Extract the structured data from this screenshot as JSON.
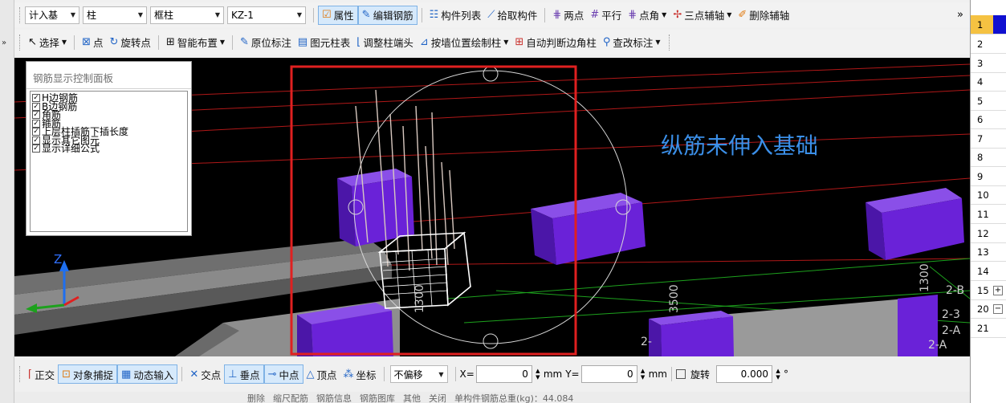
{
  "toolbar1": {
    "combo1": "计入基",
    "combo2": "柱",
    "combo3": "框柱",
    "combo4": "KZ-1",
    "properties": "属性",
    "edit_rebar": "编辑钢筋",
    "component_list": "构件列表",
    "pick_component": "拾取构件",
    "two_points": "两点",
    "parallel": "平行",
    "point_angle": "点角",
    "three_point_axis": "三点辅轴",
    "delete_axis": "删除辅轴",
    "overflow": "»"
  },
  "toolbar2": {
    "select": "选择",
    "point": "点",
    "rotate_point": "旋转点",
    "smart_layout": "智能布置",
    "in_place_label": "原位标注",
    "element_column_table": "图元柱表",
    "adjust_column_end": "调整柱端头",
    "draw_column_by_wall": "按墙位置绘制柱",
    "auto_corner_column": "自动判断边角柱",
    "check_label": "查改标注"
  },
  "panel": {
    "title": "钢筋显示控制面板",
    "items": [
      {
        "label": "H边钢筋",
        "checked": true
      },
      {
        "label": "B边钢筋",
        "checked": true
      },
      {
        "label": "角筋",
        "checked": true
      },
      {
        "label": "箍筋",
        "checked": true
      },
      {
        "label": "上层柱插筋下插长度",
        "checked": true
      },
      {
        "label": "显示其它图元",
        "checked": true
      },
      {
        "label": "显示详细公式",
        "checked": true
      }
    ]
  },
  "viewport": {
    "annotation": "纵筋未伸入基础",
    "dim_1300_left": "1300",
    "dim_3500": "3500",
    "dim_1300_right": "1300",
    "label_2b": "2-B",
    "label_23": "2-3",
    "label_2a_a": "2-A",
    "label_2a_b": "2-A",
    "label_2_left": "2-",
    "axis_z": "Z",
    "accent_annotation": "#3b8fe8",
    "highlight_color": "#e02020",
    "block_color": "#6a22d8"
  },
  "rows": [
    "1",
    "2",
    "3",
    "4",
    "5",
    "6",
    "7",
    "8",
    "9",
    "10",
    "11",
    "12",
    "13",
    "14",
    "15",
    "20",
    "21"
  ],
  "statusbar": {
    "orthogonal": "正交",
    "object_snap": "对象捕捉",
    "dynamic_input": "动态输入",
    "intersection": "交点",
    "perpendicular": "垂点",
    "midpoint": "中点",
    "vertex": "顶点",
    "coordinate": "坐标",
    "offset_mode": "不偏移",
    "x_label": "X=",
    "x_value": "0",
    "mm1": "mm",
    "y_label": "Y=",
    "y_value": "0",
    "mm2": "mm",
    "rotate_label": "旋转",
    "rotate_value": "0.000",
    "deg": "°"
  },
  "bottombar": {
    "delete": "删除",
    "reduce_rebar": "缩尺配筋",
    "rebar_info": "钢筋信息",
    "rebar_drawing": "钢筋图库",
    "other": "其他",
    "close": "关闭",
    "total_weight": "单构件钢筋总重(kg)：44.084"
  }
}
